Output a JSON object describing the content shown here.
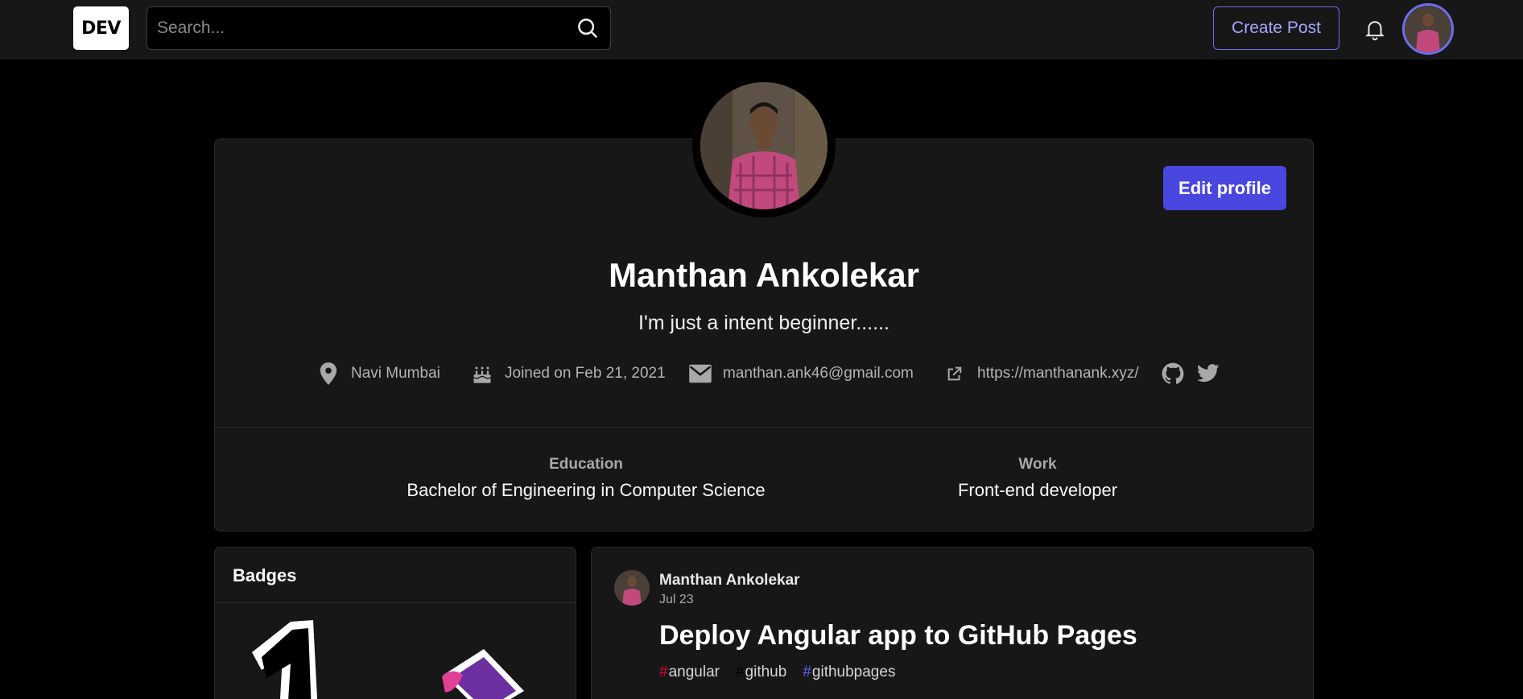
{
  "header": {
    "logo_text": "DEV",
    "search_placeholder": "Search...",
    "create_post_label": "Create Post"
  },
  "profile": {
    "name": "Manthan Ankolekar",
    "bio": "I'm just a intent beginner......",
    "edit_label": "Edit profile",
    "location": "Navi Mumbai",
    "joined": "Joined on Feb 21, 2021",
    "email": "manthan.ank46@gmail.com",
    "website": "https://manthanank.xyz/",
    "education_label": "Education",
    "education_value": "Bachelor of Engineering in Computer Science",
    "work_label": "Work",
    "work_value": "Front-end developer"
  },
  "badges": {
    "title": "Badges"
  },
  "post": {
    "author": "Manthan Ankolekar",
    "date": "Jul 23",
    "title": "Deploy Angular app to GitHub Pages",
    "tags": [
      {
        "name": "angular",
        "color": "#dd0031"
      },
      {
        "name": "github",
        "color": "#000000"
      },
      {
        "name": "githubpages",
        "color": "#5865f2"
      }
    ]
  },
  "colors": {
    "accent": "#4a46e0",
    "accent_outline": "#6c6ff0",
    "card_bg": "#171717"
  }
}
